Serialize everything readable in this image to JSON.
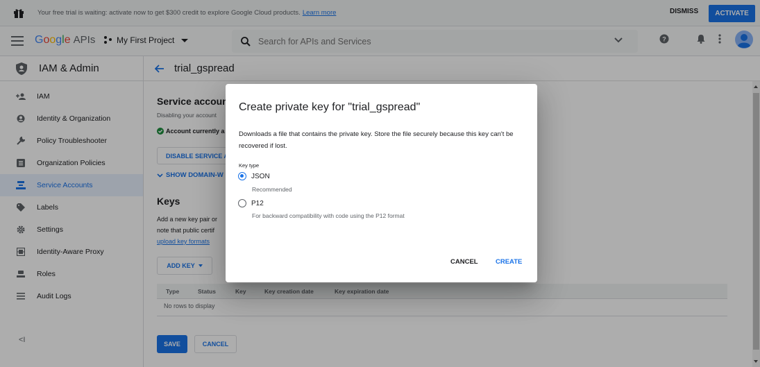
{
  "banner": {
    "message": "Your free trial is waiting: activate now to get $300 credit to explore Google Cloud products.",
    "link": "Learn more",
    "dismiss": "DISMISS",
    "activate": "ACTIVATE"
  },
  "header": {
    "logo_google": [
      "G",
      "o",
      "o",
      "g",
      "l",
      "e"
    ],
    "logo_apis": "APIs",
    "project": "My First Project",
    "search_placeholder": "Search for APIs and Services"
  },
  "sidebar": {
    "title": "IAM & Admin",
    "items": [
      {
        "label": "IAM",
        "icon": "person-add-icon"
      },
      {
        "label": "Identity & Organization",
        "icon": "account-circle-icon"
      },
      {
        "label": "Policy Troubleshooter",
        "icon": "wrench-icon"
      },
      {
        "label": "Organization Policies",
        "icon": "list-box-icon"
      },
      {
        "label": "Service Accounts",
        "icon": "service-account-icon",
        "active": true
      },
      {
        "label": "Labels",
        "icon": "label-icon"
      },
      {
        "label": "Settings",
        "icon": "gear-icon"
      },
      {
        "label": "Identity-Aware Proxy",
        "icon": "proxy-icon"
      },
      {
        "label": "Roles",
        "icon": "roles-icon"
      },
      {
        "label": "Audit Logs",
        "icon": "audit-logs-icon"
      }
    ],
    "collapse": "<I"
  },
  "main": {
    "crumb": "trial_gspread",
    "sa_heading": "Service accoun",
    "sa_disable_text": "Disabling your account",
    "account_status": "Account currently a",
    "disable_btn": "DISABLE SERVICE A",
    "show_domain": "SHOW DOMAIN-W",
    "keys_heading": "Keys",
    "keys_text_1": "Add a new key pair or",
    "keys_text_2": "note that public certif",
    "keys_link": "upload key formats",
    "add_key": "ADD KEY",
    "table_headers": [
      "Type",
      "Status",
      "Key",
      "Key creation date",
      "Key expiration date"
    ],
    "empty_text": "No rows to display",
    "save": "SAVE",
    "cancel": "CANCEL"
  },
  "dialog": {
    "title": "Create private key for \"trial_gspread\"",
    "description": "Downloads a file that contains the private key. Store the file securely because this key can't be recovered if lost.",
    "key_type_label": "Key type",
    "options": [
      {
        "label": "JSON",
        "hint": "Recommended",
        "selected": true
      },
      {
        "label": "P12",
        "hint": "For backward compatibility with code using the P12 format",
        "selected": false
      }
    ],
    "cancel": "CANCEL",
    "create": "CREATE"
  },
  "colors": {
    "accent": "#1a73e8",
    "overlay": "rgba(0,0,0,0.32)",
    "status_green": "#1e8e3e"
  }
}
